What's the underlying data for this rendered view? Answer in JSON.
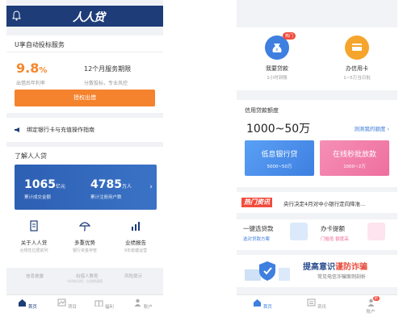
{
  "left": {
    "logo": "人人贷",
    "u_plan": {
      "title": "U享自动投标服务",
      "rate_value": "9.8",
      "rate_unit": "%",
      "rate_label": "出借后年利率",
      "term": "12个月服务期限",
      "term_label": "分散投标，专业风控",
      "button": "授权出借"
    },
    "bind_guide": "绑定银行卡与充值操作指南",
    "know": {
      "title": "了解人人贷",
      "stats": [
        {
          "value": "1065",
          "unit": "亿元",
          "label": "累计成交金额"
        },
        {
          "value": "4785",
          "unit": "万人",
          "label": "累计注册用户数"
        }
      ],
      "features": [
        {
          "title": "关于人人贷",
          "sub": "合规性位居前列"
        },
        {
          "title": "多重优势",
          "sub": "银行资金存管"
        },
        {
          "title": "业绩报告",
          "sub": "9年稳健运营"
        }
      ]
    },
    "footer_links": [
      "信息披露",
      "出借人教育",
      "风险提示"
    ],
    "footer_note": "市场有风险，出借需谨慎",
    "tabs": [
      "首页",
      "项目",
      "福利",
      "账户"
    ]
  },
  "right": {
    "top_items": [
      {
        "title": "我要贷款",
        "sub": "1小时到账",
        "badge": "热门"
      },
      {
        "title": "办信用卡",
        "sub": "1~5万当日批"
      }
    ],
    "credit": {
      "title": "信用贷款额度",
      "amount": "1000~50万",
      "link": "测测我的额度",
      "boxes": [
        {
          "title": "低息银行贷",
          "range": "5000~50万"
        },
        {
          "title": "在线秒批放款",
          "range": "1000~2万"
        }
      ]
    },
    "hot": {
      "tag": "热门资讯",
      "text": "央行决定4月对中小银行定向降准..."
    },
    "services": [
      {
        "title": "一键选贷款",
        "sub": "选对贷款方案"
      },
      {
        "title": "办卡提额",
        "sub": "门槛低 额度高"
      }
    ],
    "fraud": {
      "title_a": "提高意识",
      "title_b": "谨防诈骗",
      "sub": "常见电信诈骗案例剖析"
    },
    "tabs": [
      "首页",
      "资讯",
      "账户"
    ],
    "tab_badge": "新"
  },
  "colors": {
    "brand_navy": "#1d3c78",
    "orange": "#f5822c",
    "blue": "#3a73c6",
    "red": "#f24b3c"
  }
}
